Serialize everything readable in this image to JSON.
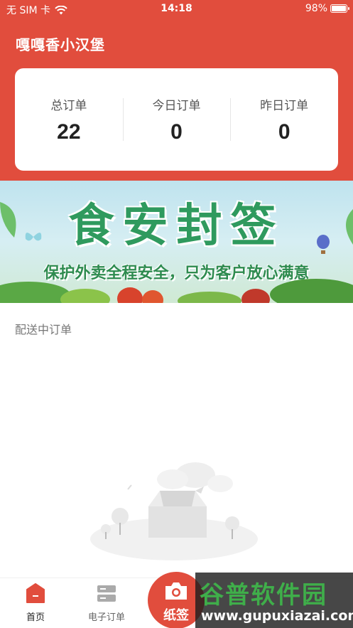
{
  "status_bar": {
    "carrier": "无 SIM 卡",
    "time": "14:18",
    "battery": "98%",
    "battery_level": 0.98
  },
  "store": {
    "name": "嘎嘎香小汉堡"
  },
  "stats": [
    {
      "label": "总订单",
      "value": "22"
    },
    {
      "label": "今日订单",
      "value": "0"
    },
    {
      "label": "昨日订单",
      "value": "0"
    }
  ],
  "banner": {
    "title": "食安封签",
    "subtitle": "保护外卖全程安全，只为客户放心满意"
  },
  "section": {
    "title": "配送中订单"
  },
  "tabbar": {
    "home_label": "首页",
    "orders_label": "电子订单",
    "sign_label": "纸签"
  },
  "watermark": {
    "main": "谷普软件园",
    "url": "www.gupuxiazai.com"
  },
  "colors": {
    "brand": "#e14d3d",
    "banner_green": "#2f9a5e"
  }
}
